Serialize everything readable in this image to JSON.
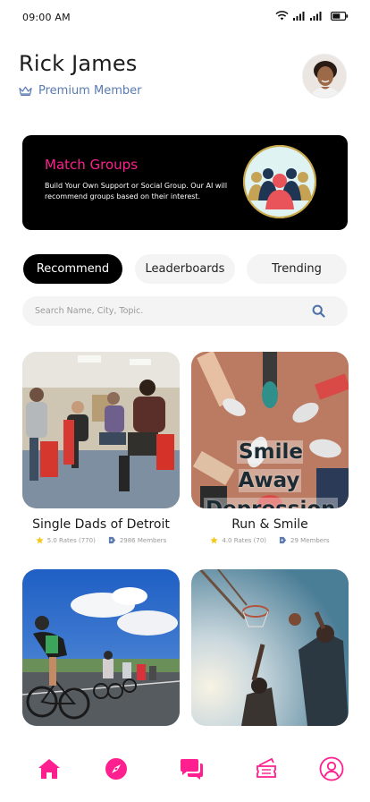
{
  "status": {
    "time": "09:00 AM"
  },
  "header": {
    "name": "Rick James",
    "membership": "Premium Member"
  },
  "banner": {
    "title": "Match Groups",
    "description": "Build Your Own Support or Social Group. Our AI will recommend groups based on their interest."
  },
  "tabs": [
    {
      "label": "Recommend",
      "active": true
    },
    {
      "label": "Leaderboards",
      "active": false
    },
    {
      "label": "Trending",
      "active": false
    }
  ],
  "search": {
    "placeholder": "Search Name, City, Topic."
  },
  "groups": [
    {
      "title": "Single Dads of Detroit",
      "rates": "5.0 Rates (770)",
      "members": "2986 Members"
    },
    {
      "title": "Run & Smile",
      "image_text_line1": "Smile Away",
      "image_text_line2": "Depression",
      "rates": "4.0 Rates (70)",
      "members": "29 Members"
    },
    {
      "title": "",
      "rates": "",
      "members": ""
    },
    {
      "title": "",
      "rates": "",
      "members": ""
    }
  ],
  "nav": {
    "items": [
      "home-icon",
      "compass-icon",
      "chat-icon",
      "ticket-icon",
      "profile-icon"
    ],
    "accent": "#ff1f8e"
  },
  "colors": {
    "accent_pink": "#ff1f8e",
    "member_blue": "#5a7ab0",
    "star_yellow": "#f5c518"
  }
}
